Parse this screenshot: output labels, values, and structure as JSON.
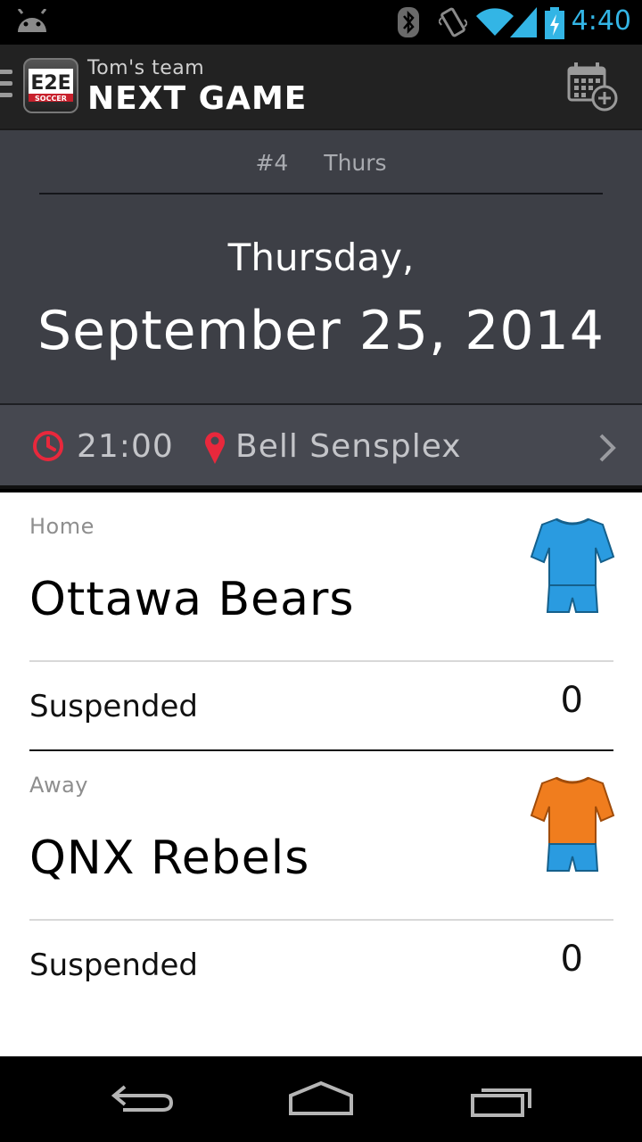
{
  "status_bar": {
    "time": "4:40",
    "icons": [
      "android-icon",
      "bluetooth-icon",
      "vibrate-icon",
      "wifi-icon",
      "signal-icon",
      "battery-charging-icon"
    ]
  },
  "action_bar": {
    "subtitle": "Tom's team",
    "title": "NEXT GAME",
    "logo_text": "E2E",
    "logo_subtext": "SOCCER",
    "add_calendar_icon": "calendar-add-icon"
  },
  "game": {
    "number": "#4",
    "day_short": "Thurs",
    "day_of_week": "Thursday,",
    "date": "September 25, 2014",
    "time": "21:00",
    "venue": "Bell Sensplex"
  },
  "home": {
    "label": "Home",
    "team": "Ottawa Bears",
    "suspended_label": "Suspended",
    "suspended_count": "0",
    "jersey_color": "#2a9be0"
  },
  "away": {
    "label": "Away",
    "team": "QNX Rebels",
    "suspended_label": "Suspended",
    "suspended_count": "0",
    "jersey_color": "#f07d1e"
  },
  "colors": {
    "accent": "#33b5e5",
    "icon_red": "#e8283c",
    "header_bg": "#3d3f46"
  }
}
